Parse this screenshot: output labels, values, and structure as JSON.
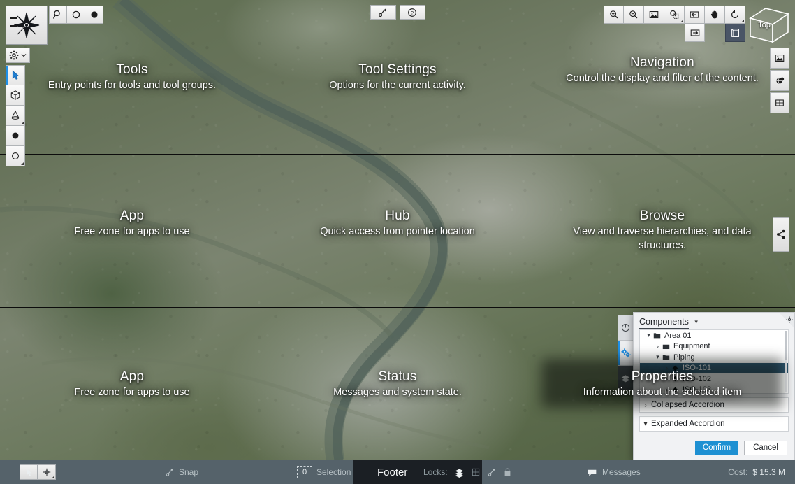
{
  "app": {
    "logo_icon": "compass-rose-icon",
    "menu_icon": "hamburger-menu-icon"
  },
  "tools_toolbar": {
    "buttons": [
      {
        "label": "",
        "icon": "search-measure-icon",
        "name": "tool-measure"
      },
      {
        "label": "",
        "icon": "circle-outline-icon",
        "name": "tool-circle"
      },
      {
        "label": "",
        "icon": "circle-filled-icon",
        "name": "tool-solid"
      }
    ]
  },
  "tool_rail": {
    "gear": {
      "icon": "gear-icon",
      "caret": "chevron-down-icon"
    },
    "items": [
      {
        "icon": "cursor-arrow-icon",
        "name": "tool-select",
        "active": true
      },
      {
        "icon": "cube-icon",
        "name": "tool-cube",
        "active": false
      },
      {
        "icon": "cone-icon",
        "name": "tool-cone",
        "active": false
      },
      {
        "icon": "sphere-filled-icon",
        "name": "tool-sphere",
        "active": false
      },
      {
        "icon": "circle-outline-icon",
        "name": "tool-ring",
        "active": false
      }
    ]
  },
  "tool_settings": {
    "buttons": [
      {
        "icon": "wrench-icon",
        "name": "tool-settings-wrench"
      },
      {
        "icon": "help-circle-icon",
        "name": "tool-settings-help"
      }
    ]
  },
  "navigation": {
    "buttons": [
      {
        "icon": "zoom-in-icon",
        "name": "nav-zoom-in"
      },
      {
        "icon": "zoom-out-icon",
        "name": "nav-zoom-out"
      },
      {
        "icon": "fit-view-icon",
        "name": "nav-fit-view"
      },
      {
        "icon": "zoom-window-icon",
        "name": "nav-zoom-window"
      },
      {
        "icon": "arrow-left-box-icon",
        "name": "nav-previous-view"
      },
      {
        "icon": "pan-hand-icon",
        "name": "nav-pan"
      },
      {
        "icon": "rotate-icon",
        "name": "nav-rotate"
      }
    ],
    "row2": [
      {
        "icon": "arrow-right-box-icon",
        "name": "nav-next-view"
      },
      {
        "icon": "section-box-icon",
        "name": "nav-section",
        "selected": true
      }
    ],
    "viewcube_label": "Top"
  },
  "right_rail": {
    "items": [
      {
        "icon": "image-icon",
        "name": "rail-image"
      },
      {
        "icon": "globe-icon",
        "name": "rail-globe"
      },
      {
        "icon": "grid-icon",
        "name": "rail-grid"
      }
    ],
    "share": {
      "icon": "share-icon",
      "name": "share-button"
    }
  },
  "zones": [
    {
      "title": "Tools",
      "desc": "Entry points for tools and tool groups."
    },
    {
      "title": "Tool Settings",
      "desc": "Options for the current activity."
    },
    {
      "title": "Navigation",
      "desc": "Control the display and filter of the content."
    },
    {
      "title": "App",
      "desc": "Free zone for apps to use"
    },
    {
      "title": "Hub",
      "desc": "Quick access from pointer location"
    },
    {
      "title": "Browse",
      "desc": "View and traverse hierarchies, and data structures."
    },
    {
      "title": "App",
      "desc": "Free zone for apps to use"
    },
    {
      "title": "Status",
      "desc": "Messages and system state."
    },
    {
      "title": "Properties",
      "desc": "Information about the selected item"
    }
  ],
  "panel": {
    "tab_label": "Components",
    "tab_caret": "chevron-down-icon",
    "settings_icon": "gear-icon",
    "tree": [
      {
        "label": "Area 01",
        "indent": 0,
        "expander": "chevron-down-icon",
        "icon": "folder-open-icon",
        "selected": false
      },
      {
        "label": "Equipment",
        "indent": 1,
        "expander": "chevron-right-icon",
        "icon": "folder-closed-icon",
        "selected": false
      },
      {
        "label": "Piping",
        "indent": 1,
        "expander": "chevron-down-icon",
        "icon": "folder-open-icon",
        "selected": false
      },
      {
        "label": "ISO-101",
        "indent": 2,
        "expander": "chevron-right-icon",
        "icon": "diamond-icon",
        "selected": true
      },
      {
        "label": "ISO-102",
        "indent": 2,
        "expander": "chevron-right-icon",
        "icon": "diamond-icon",
        "selected": false
      },
      {
        "label": "ISO-103",
        "indent": 2,
        "expander": "chevron-right-icon",
        "icon": "diamond-icon",
        "selected": false
      }
    ],
    "accordions": [
      {
        "label": "Collapsed Accordion",
        "chevron": "chevron-right-icon"
      },
      {
        "label": "Expanded Accordion",
        "chevron": "chevron-down-icon"
      }
    ],
    "confirm_label": "Confirm",
    "cancel_label": "Cancel",
    "vertical_tabs": [
      {
        "icon": "info-circle-icon",
        "name": "panel-tab-info",
        "active": false
      },
      {
        "icon": "gears-icon",
        "name": "panel-tab-components",
        "active": true
      },
      {
        "icon": "layers-icon",
        "name": "panel-tab-layers",
        "active": false
      }
    ]
  },
  "footer": {
    "select_icon": "cursor-arrow-icon",
    "snap_point_icon": "snap-point-icon",
    "snap_label": "Snap",
    "snap_icon": "snap-icon",
    "selection_count": "0",
    "selection_label": "Selection",
    "title": "Footer",
    "locks_label": "Locks:",
    "lock_icons": [
      {
        "icon": "layers-icon",
        "name": "lock-layers"
      },
      {
        "icon": "grid-icon",
        "name": "lock-grid"
      },
      {
        "icon": "snap-icon",
        "name": "lock-snap"
      },
      {
        "icon": "padlock-icon",
        "name": "lock-padlock"
      }
    ],
    "messages_icon": "speech-bubble-icon",
    "messages_label": "Messages",
    "cost_label": "Cost:",
    "cost_value": "$ 15.3 M"
  },
  "colors": {
    "accent": "#1e90d2",
    "selection": "#2e5872",
    "footer_bg": "#55626a",
    "footer_dark": "#1b1f24"
  }
}
